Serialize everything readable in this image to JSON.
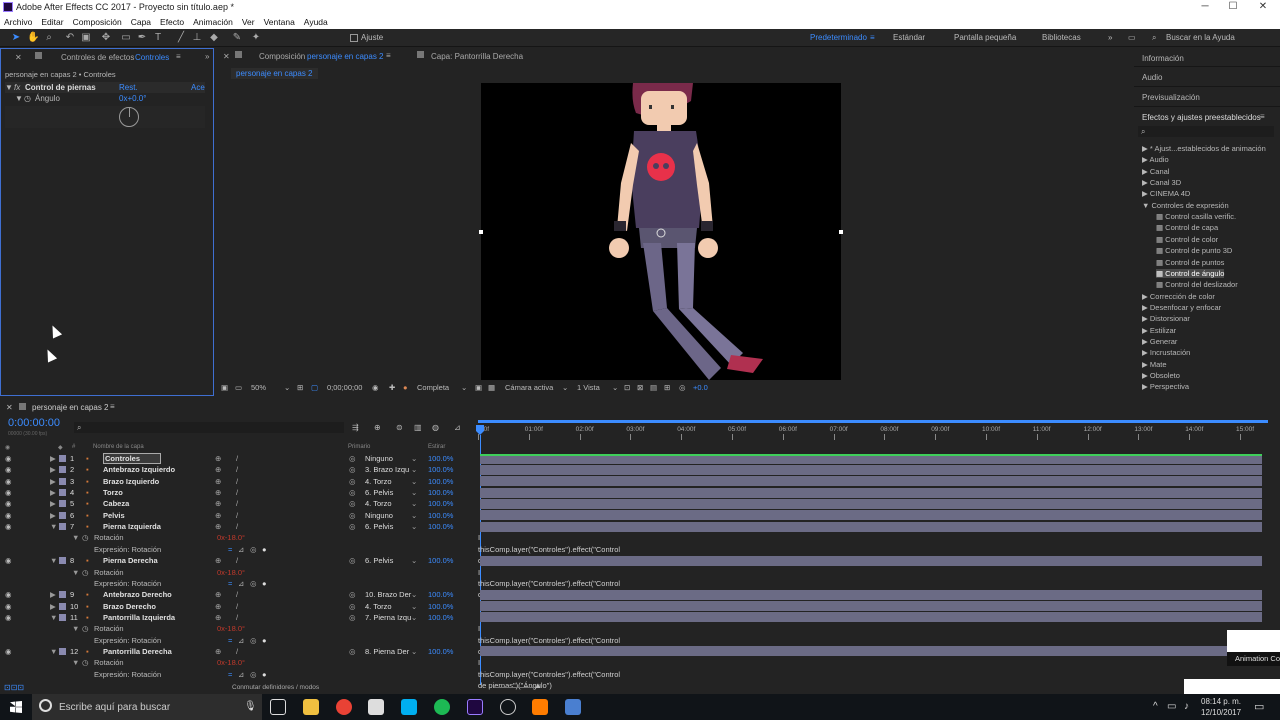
{
  "window": {
    "title": "Adobe After Effects CC 2017 - Proyecto sin título.aep *",
    "min": "─",
    "max": "☐",
    "close": "✕"
  },
  "menu": [
    "Archivo",
    "Editar",
    "Composición",
    "Capa",
    "Efecto",
    "Animación",
    "Ver",
    "Ventana",
    "Ayuda"
  ],
  "toolbar": {
    "snap_label": "Ajuste",
    "workspaces": [
      "Predeterminado",
      "Estándar",
      "Pantalla pequeña",
      "Bibliotecas"
    ],
    "active_workspace": "Predeterminado",
    "search_placeholder": "Buscar en la Ayuda"
  },
  "effects_panel": {
    "tab_prefix": "Controles de efectos",
    "tab_layer": "Controles",
    "breadcrumb": "personaje en capas 2 • Controles",
    "effect_name": "Control de piernas",
    "reset": "Rest.",
    "about": "Ace",
    "param_name": "Ángulo",
    "param_value": "0x+0.0°"
  },
  "comp_panel": {
    "tab_prefix": "Composición",
    "tab_name": "personaje en capas 2",
    "layer_tab": "Capa: Pantorrilla Derecha",
    "subtab": "personaje en capas 2",
    "zoom": "50%",
    "timecode": "0;00;00;00",
    "resolution": "Completa",
    "camera": "Cámara activa",
    "views": "1 Vista",
    "exposure": "+0.0"
  },
  "right_panel": {
    "info": "Información",
    "audio": "Audio",
    "preview": "Previsualización",
    "effects_title": "Efectos y ajustes preestablecidos",
    "search_placeholder": "",
    "tree": [
      {
        "label": "* Ajust...establecidos de animación",
        "expanded": false,
        "level": 0
      },
      {
        "label": "Audio",
        "expanded": false,
        "level": 0
      },
      {
        "label": "Canal",
        "expanded": false,
        "level": 0
      },
      {
        "label": "Canal 3D",
        "expanded": false,
        "level": 0
      },
      {
        "label": "CINEMA 4D",
        "expanded": false,
        "level": 0
      },
      {
        "label": "Controles de expresión",
        "expanded": true,
        "level": 0
      },
      {
        "label": "Control casilla verific.",
        "level": 1
      },
      {
        "label": "Control de capa",
        "level": 1
      },
      {
        "label": "Control de color",
        "level": 1
      },
      {
        "label": "Control de punto 3D",
        "level": 1
      },
      {
        "label": "Control de puntos",
        "level": 1
      },
      {
        "label": "Control de ángulo",
        "level": 1,
        "selected": true
      },
      {
        "label": "Control del deslizador",
        "level": 1
      },
      {
        "label": "Corrección de color",
        "expanded": false,
        "level": 0
      },
      {
        "label": "Desenfocar y enfocar",
        "expanded": false,
        "level": 0
      },
      {
        "label": "Distorsionar",
        "expanded": false,
        "level": 0
      },
      {
        "label": "Estilizar",
        "expanded": false,
        "level": 0
      },
      {
        "label": "Generar",
        "expanded": false,
        "level": 0
      },
      {
        "label": "Incrustación",
        "expanded": false,
        "level": 0
      },
      {
        "label": "Mate",
        "expanded": false,
        "level": 0
      },
      {
        "label": "Obsoleto",
        "expanded": false,
        "level": 0
      },
      {
        "label": "Perspectiva",
        "expanded": false,
        "level": 0
      }
    ]
  },
  "timeline": {
    "tab": "personaje en capas 2",
    "timecode": "0:00:00:00",
    "fps": "00000 (30.00 fps)",
    "col_name": "Nombre de la capa",
    "col_parent": "Primario",
    "col_stretch": "Estirar",
    "footer": "Conmutar definidores / modos",
    "ruler": [
      "00f",
      "01:00f",
      "02:00f",
      "03:00f",
      "04:00f",
      "05:00f",
      "06:00f",
      "07:00f",
      "08:00f",
      "09:00f",
      "10:00f",
      "11:00f",
      "12:00f",
      "13:00f",
      "14:00f",
      "15:00f"
    ],
    "rows": [
      {
        "type": "layer",
        "num": "1",
        "name": "Controles",
        "parent": "Ninguno",
        "stretch": "100.0%",
        "selected": true
      },
      {
        "type": "layer",
        "num": "2",
        "name": "Antebrazo Izquierdo",
        "parent": "3. Brazo Izqu",
        "stretch": "100.0%"
      },
      {
        "type": "layer",
        "num": "3",
        "name": "Brazo Izquierdo",
        "parent": "4. Torzo",
        "stretch": "100.0%"
      },
      {
        "type": "layer",
        "num": "4",
        "name": "Torzo",
        "parent": "6. Pelvis",
        "stretch": "100.0%"
      },
      {
        "type": "layer",
        "num": "5",
        "name": "Cabeza",
        "parent": "4. Torzo",
        "stretch": "100.0%"
      },
      {
        "type": "layer",
        "num": "6",
        "name": "Pelvis",
        "parent": "Ninguno",
        "stretch": "100.0%"
      },
      {
        "type": "layer",
        "num": "7",
        "name": "Pierna Izquierda",
        "parent": "6. Pelvis",
        "stretch": "100.0%",
        "expanded": true
      },
      {
        "type": "prop",
        "name": "Rotación",
        "value": "0x-18.0°"
      },
      {
        "type": "expr",
        "name": "Expresión: Rotación",
        "code": "thisComp.layer(\"Controles\").effect(\"Control de piernas\")(\"Ángulo\")"
      },
      {
        "type": "layer",
        "num": "8",
        "name": "Pierna Derecha",
        "parent": "6. Pelvis",
        "stretch": "100.0%",
        "expanded": true
      },
      {
        "type": "prop",
        "name": "Rotación",
        "value": "0x-18.0°"
      },
      {
        "type": "expr",
        "name": "Expresión: Rotación",
        "code": "thisComp.layer(\"Controles\").effect(\"Control de piernas\")(\"Ángulo\")"
      },
      {
        "type": "layer",
        "num": "9",
        "name": "Antebrazo Derecho",
        "parent": "10. Brazo Der",
        "stretch": "100.0%"
      },
      {
        "type": "layer",
        "num": "10",
        "name": "Brazo Derecho",
        "parent": "4. Torzo",
        "stretch": "100.0%"
      },
      {
        "type": "layer",
        "num": "11",
        "name": "Pantorrilla Izquierda",
        "parent": "7. Pierna Izqu",
        "stretch": "100.0%",
        "expanded": true
      },
      {
        "type": "prop",
        "name": "Rotación",
        "value": "0x-18.0°"
      },
      {
        "type": "expr",
        "name": "Expresión: Rotación",
        "code": "thisComp.layer(\"Controles\").effect(\"Control de piernas\")(\"Ángulo\")"
      },
      {
        "type": "layer",
        "num": "12",
        "name": "Pantorrilla Derecha",
        "parent": "8. Pierna Der",
        "stretch": "100.0%",
        "expanded": true
      },
      {
        "type": "prop",
        "name": "Rotación",
        "value": "0x-18.0°"
      },
      {
        "type": "expr",
        "name": "Expresión: Rotación",
        "code": "thisComp.layer(\"Controles\").effect(\"Control de piernas\")(\"Ángulo\")"
      }
    ]
  },
  "popup": {
    "text": "Animation Co"
  },
  "taskbar": {
    "search_placeholder": "Escribe aquí para buscar",
    "time": "08:14 p. m.",
    "date": "12/10/2017"
  },
  "colors": {
    "accent": "#3c8cff",
    "bar": "#6b6b85",
    "label_red": "#c0392b"
  }
}
